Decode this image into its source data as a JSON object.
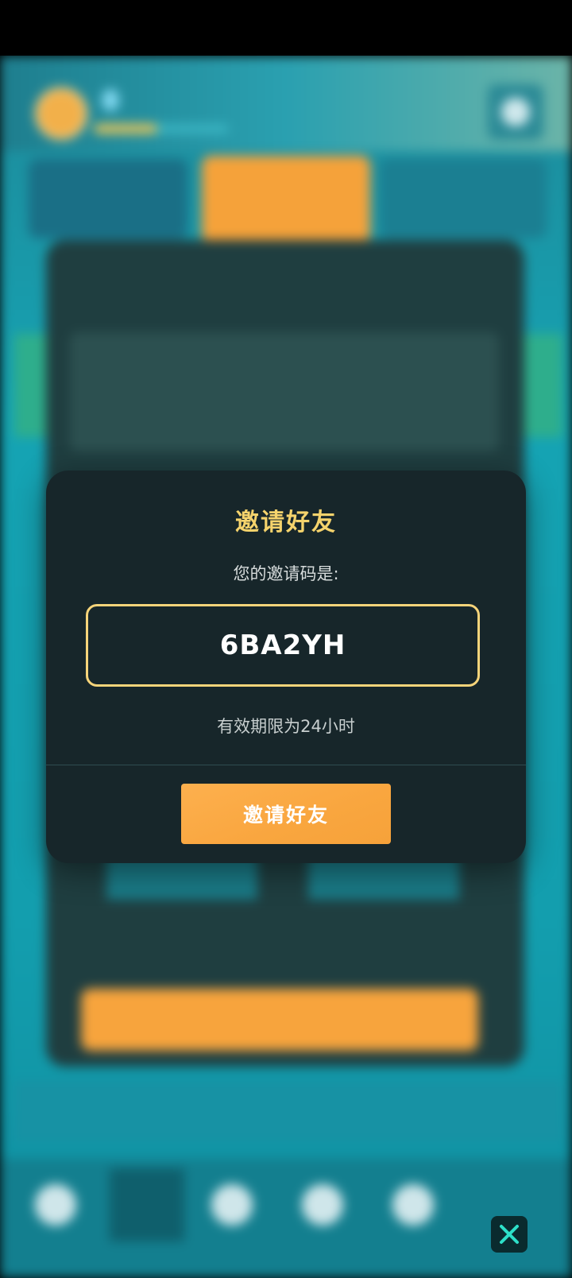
{
  "modal": {
    "title": "邀请好友",
    "code_label": "您的邀请码是:",
    "invite_code": "6BA2YH",
    "validity": "有效期限为24小时",
    "invite_button_label": "邀请好友"
  },
  "nav": {
    "close_icon": "close-icon"
  },
  "colors": {
    "title_gold": "#f5d36c",
    "code_border": "#f6d47a",
    "button_orange": "#f9a63f",
    "modal_bg": "#17262a"
  }
}
